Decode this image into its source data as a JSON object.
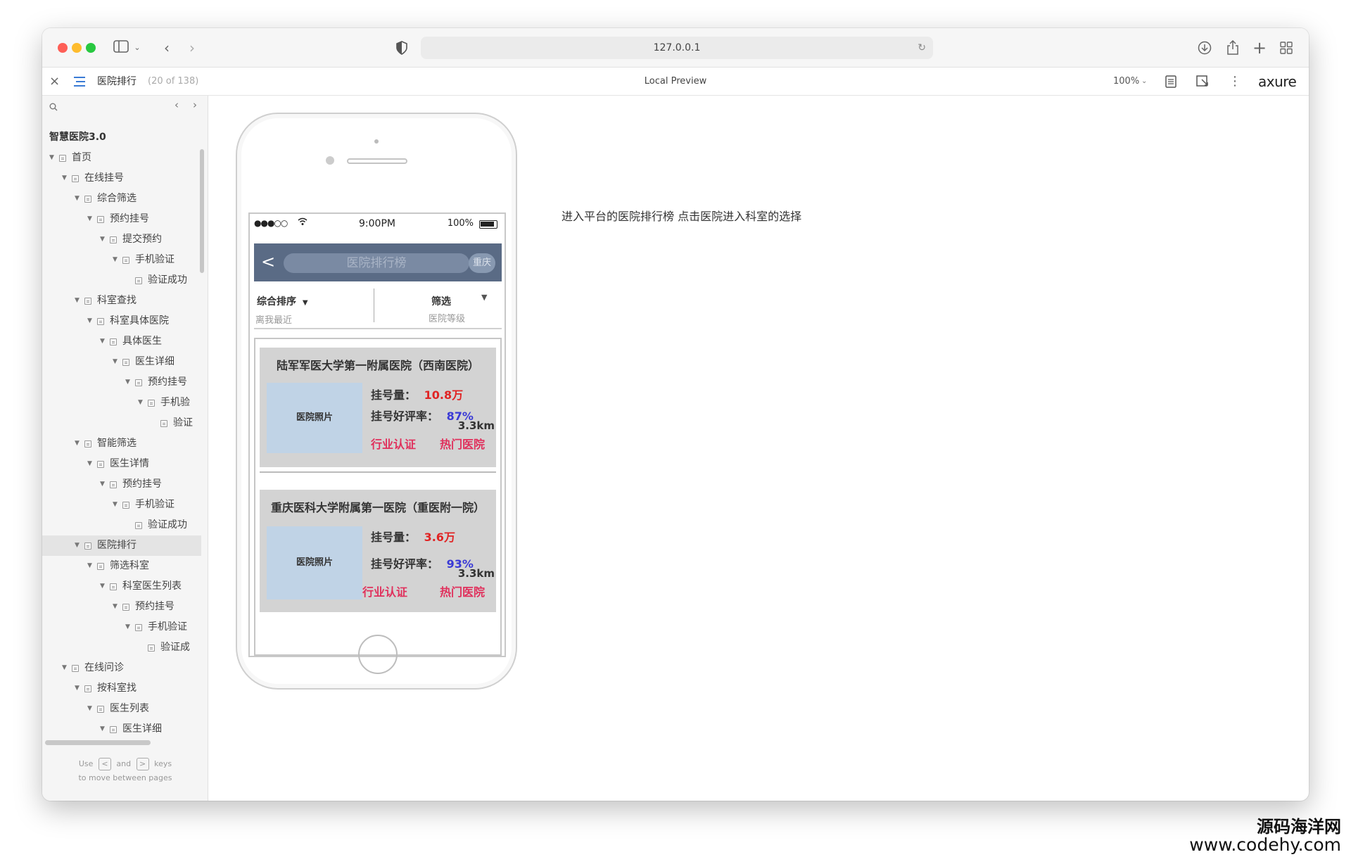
{
  "browser": {
    "url": "127.0.0.1"
  },
  "axure_bar": {
    "close": "×",
    "page_name": "医院排行",
    "page_count": "(20 of 138)",
    "preview_title": "Local Preview",
    "zoom": "100%",
    "brand": "axure"
  },
  "sidebar": {
    "project_title": "智慧医院3.0",
    "tree": [
      {
        "label": "首页",
        "level": 0,
        "expanded": true
      },
      {
        "label": "在线挂号",
        "level": 1,
        "expanded": true
      },
      {
        "label": "综合筛选",
        "level": 2,
        "expanded": true
      },
      {
        "label": "预约挂号",
        "level": 3,
        "expanded": true
      },
      {
        "label": "提交预约",
        "level": 4,
        "expanded": true
      },
      {
        "label": "手机验证",
        "level": 5,
        "expanded": true
      },
      {
        "label": "验证成功",
        "level": 6,
        "expanded": false
      },
      {
        "label": "科室查找",
        "level": 2,
        "expanded": true
      },
      {
        "label": "科室具体医院",
        "level": 3,
        "expanded": true
      },
      {
        "label": "具体医生",
        "level": 4,
        "expanded": true
      },
      {
        "label": "医生详细",
        "level": 5,
        "expanded": true
      },
      {
        "label": "预约挂号",
        "level": 6,
        "expanded": true
      },
      {
        "label": "手机验",
        "level": 7,
        "expanded": true
      },
      {
        "label": "验证",
        "level": 8,
        "expanded": false
      },
      {
        "label": "智能筛选",
        "level": 2,
        "expanded": true
      },
      {
        "label": "医生详情",
        "level": 3,
        "expanded": true
      },
      {
        "label": "预约挂号",
        "level": 4,
        "expanded": true
      },
      {
        "label": "手机验证",
        "level": 5,
        "expanded": true
      },
      {
        "label": "验证成功",
        "level": 6,
        "expanded": false
      },
      {
        "label": "医院排行",
        "level": 2,
        "expanded": true,
        "selected": true
      },
      {
        "label": "筛选科室",
        "level": 3,
        "expanded": true
      },
      {
        "label": "科室医生列表",
        "level": 4,
        "expanded": true
      },
      {
        "label": "预约挂号",
        "level": 5,
        "expanded": true
      },
      {
        "label": "手机验证",
        "level": 6,
        "expanded": true
      },
      {
        "label": "验证成",
        "level": 7,
        "expanded": false
      },
      {
        "label": "在线问诊",
        "level": 1,
        "expanded": true
      },
      {
        "label": "按科室找",
        "level": 2,
        "expanded": true
      },
      {
        "label": "医生列表",
        "level": 3,
        "expanded": true
      },
      {
        "label": "医生详细",
        "level": 4,
        "expanded": true
      }
    ],
    "hint_use": "Use",
    "hint_and": "and",
    "hint_keys": "keys",
    "hint_line2": "to move between pages",
    "key_prev": "<",
    "key_next": ">"
  },
  "phone": {
    "status": {
      "signal": "●●●○○",
      "time": "9:00PM",
      "battery": "100%"
    },
    "navbar": {
      "back": "<",
      "title": "医院排行榜",
      "city": "重庆"
    },
    "filters": {
      "sort_label": "综合排序",
      "sort_caret": "▼",
      "sort_sub": "离我最近",
      "filter_label": "筛选",
      "filter_caret": "▼",
      "filter_sub": "医院等级"
    },
    "hospitals": [
      {
        "name": "陆军军医大学第一附属医院（西南医院）",
        "photo": "医院照片",
        "reg_label": "挂号量：",
        "reg_value": "10.8万",
        "rating_label": "挂号好评率：",
        "rating_value": "87%",
        "distance": "3.3km",
        "tag1": "行业认证",
        "tag2": "热门医院"
      },
      {
        "name": "重庆医科大学附属第一医院（重医附一院）",
        "photo": "医院照片",
        "reg_label": "挂号量：",
        "reg_value": "3.6万",
        "rating_label": "挂号好评率：",
        "rating_value": "93%",
        "distance": "3.3km",
        "tag1": "行业认证",
        "tag2": "热门医院"
      }
    ]
  },
  "note": "进入平台的医院排行榜 点击医院进入科室的选择",
  "watermark": {
    "line1": "源码海洋网",
    "line2": "www.codehy.com"
  }
}
